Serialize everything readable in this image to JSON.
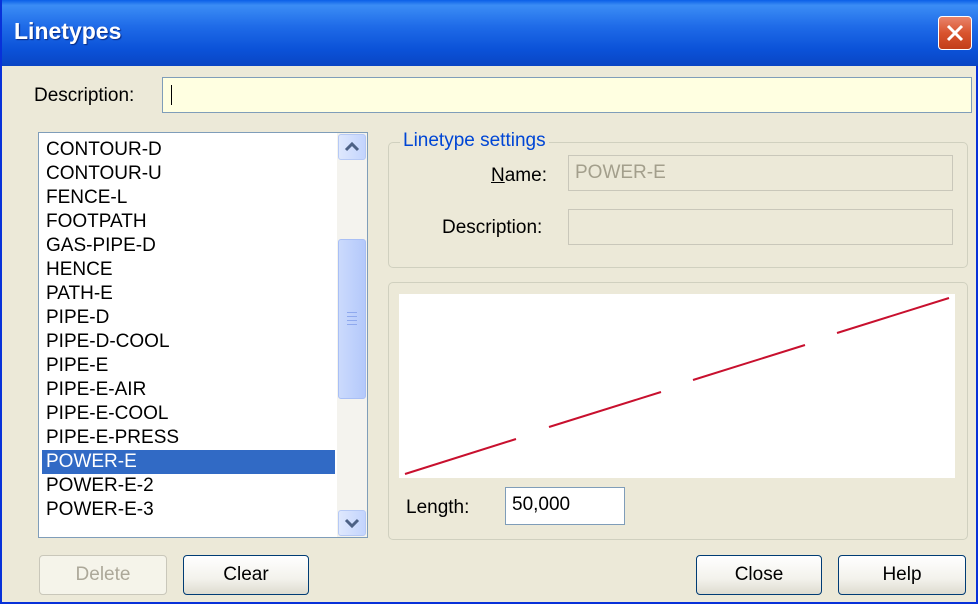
{
  "window": {
    "title": "Linetypes"
  },
  "description": {
    "label": "Description:",
    "value": ""
  },
  "linetype_list": {
    "items": [
      "CONTOUR-D",
      "CONTOUR-U",
      "FENCE-L",
      "FOOTPATH",
      "GAS-PIPE-D",
      "HENCE",
      "PATH-E",
      "PIPE-D",
      "PIPE-D-COOL",
      "PIPE-E",
      "PIPE-E-AIR",
      "PIPE-E-COOL",
      "PIPE-E-PRESS",
      "POWER-E",
      "POWER-E-2",
      "POWER-E-3"
    ],
    "selected": "POWER-E"
  },
  "settings": {
    "group_label": "Linetype settings",
    "name_label_first": "N",
    "name_label_rest": "ame:",
    "name_value": "POWER-E",
    "description_label": "Description:",
    "description_value": ""
  },
  "preview": {
    "line_color": "#c8102e"
  },
  "length": {
    "label": "Length:",
    "value": "50,000"
  },
  "buttons": {
    "delete": "Delete",
    "clear": "Clear",
    "close": "Close",
    "help": "Help"
  }
}
